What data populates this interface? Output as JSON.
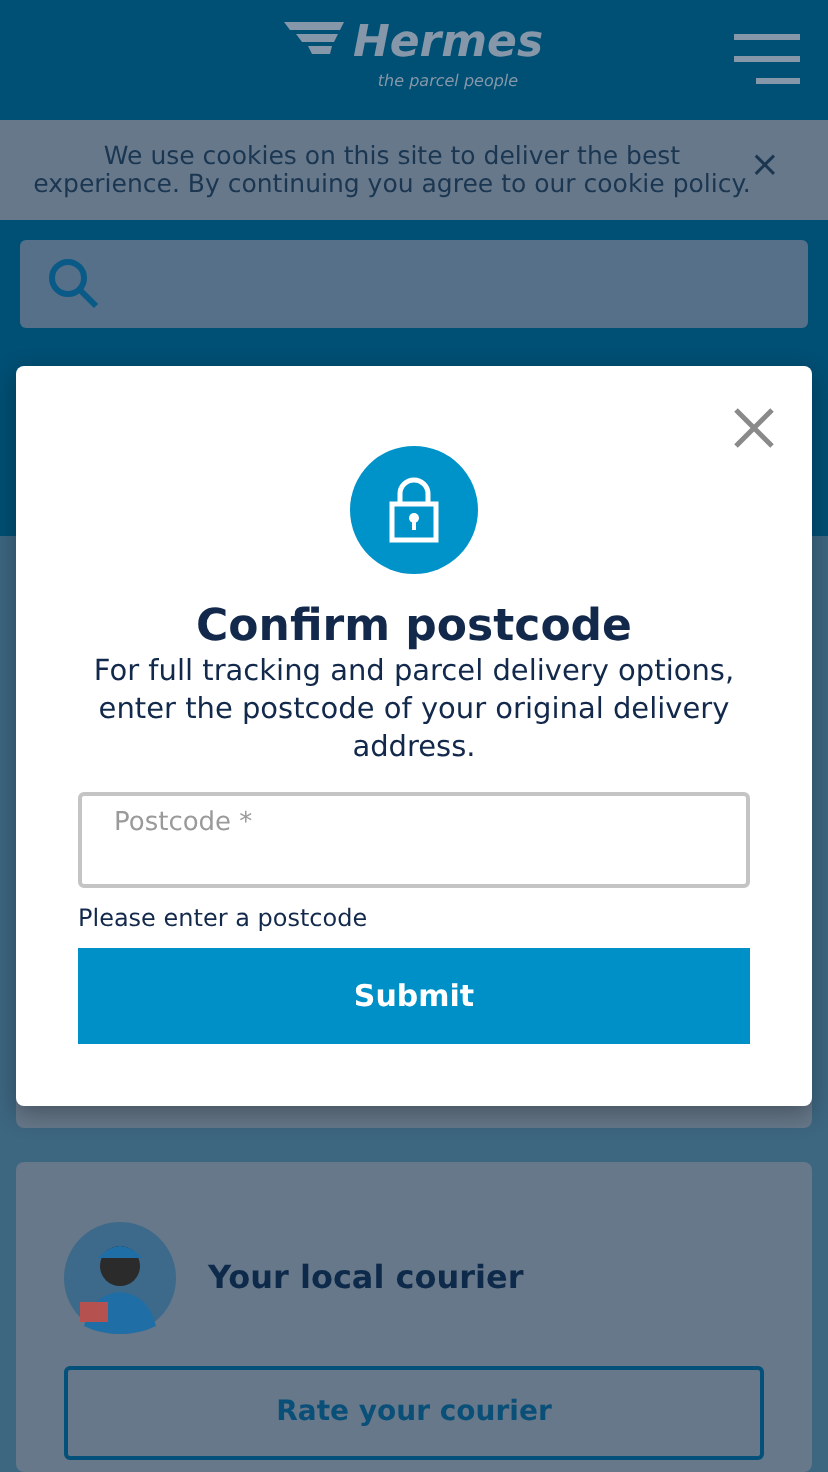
{
  "header": {
    "logo": {
      "name": "Hermes",
      "tagline": "the parcel people"
    }
  },
  "cookie_banner": {
    "text": "We use cookies on this site to deliver the best experience. By continuing you agree to our cookie policy.",
    "close": "×"
  },
  "modal": {
    "title": "Confirm postcode",
    "text": "For full tracking and parcel delivery options, enter the postcode of your original delivery address.",
    "field": {
      "placeholder": "Postcode *"
    },
    "error": "Please enter a postcode",
    "submit": "Submit"
  },
  "courier_card": {
    "title": "Your local courier",
    "button": "Rate your courier"
  }
}
